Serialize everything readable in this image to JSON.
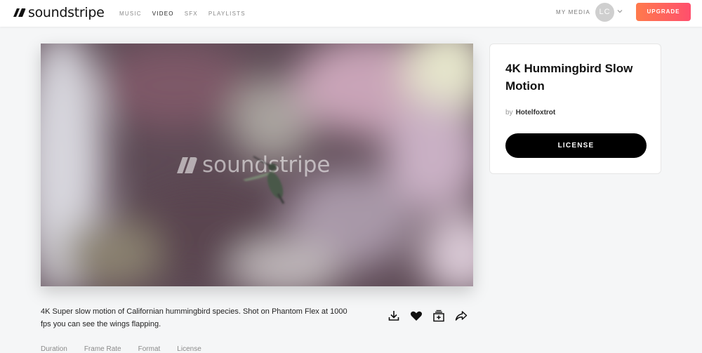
{
  "header": {
    "logo_text": "soundstripe",
    "nav": [
      "MUSIC",
      "VIDEO",
      "SFX",
      "PLAYLISTS"
    ],
    "active_nav": "VIDEO",
    "my_media": "MY MEDIA",
    "avatar_initials": "LC",
    "upgrade_label": "UPGRADE",
    "upgrade_colors": [
      "#ff7a4c",
      "#ff4f6d"
    ]
  },
  "video": {
    "watermark": "soundstripe"
  },
  "details": {
    "title": "4K Hummingbird Slow Motion",
    "by_label": "by",
    "author": "Hotelfoxtrot",
    "license_label": "LICENSE"
  },
  "description": "4K Super slow motion of Californian hummingbird species. Shot on Phantom Flex at 1000 fps you can see the wings flapping.",
  "actions": [
    "download-icon",
    "heart-icon",
    "add-to-playlist-icon",
    "share-icon"
  ],
  "meta_labels": [
    "Duration",
    "Frame Rate",
    "Format",
    "License"
  ]
}
